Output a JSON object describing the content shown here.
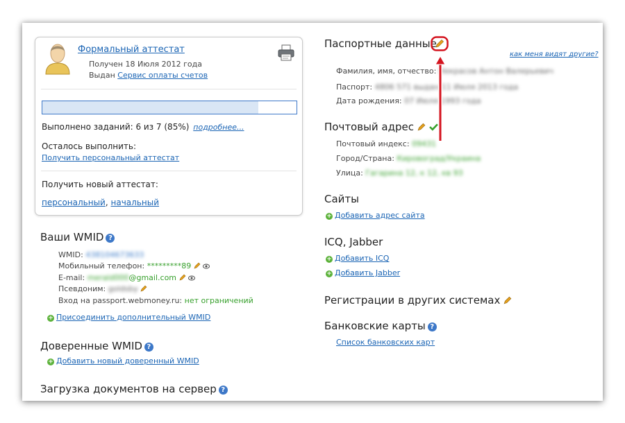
{
  "certificate": {
    "title": "Формальный аттестат",
    "received": "Получен 18 Июля 2012 года",
    "issued_prefix": "Выдан",
    "issued_link": "Сервис оплаты счетов",
    "progress_fraction": 0.85,
    "tasks_text": "Выполнено заданий: 6 из 7 (85%)",
    "more_link": "подробнее...",
    "remaining_label": "Осталось выполнить:",
    "get_personal_link": "Получить персональный аттестат",
    "new_cert_label": "Получить новый аттестат:",
    "new_personal_link": "персональный",
    "new_personal_sep": ",",
    "new_initial_link": "начальный"
  },
  "wmid": {
    "title": "Ваши WMID",
    "wmid_label": "WMID:",
    "wmid_value": "438104673633",
    "phone_label": "Мобильный телефон:",
    "phone_value": "*********89",
    "email_label": "E-mail:",
    "email_hidden": "merald000",
    "email_value": "@gmail.com",
    "nick_label": "Псевдоним:",
    "nick_value": "goldsby",
    "passport_label": "Вход на passport.webmoney.ru:",
    "passport_value": "нет ограничений",
    "attach_link": "Присоединить дополнительный WMID"
  },
  "trusted": {
    "title": "Доверенные WMID",
    "add_link": "Добавить новый доверенный WMID"
  },
  "upload": {
    "title": "Загрузка документов на сервер"
  },
  "passport": {
    "title": "Паспортные данные",
    "others_link": "как меня видят другие?",
    "fio_label": "Фамилия, имя, отчество:",
    "fio_value": "Некрасов Антон Валерьевич",
    "passport_label": "Паспорт:",
    "passport_value": "4806 571 выдан 11 Июля 2013 года",
    "birth_label": "Дата рождения:",
    "birth_value": "07 Июля 1993 года"
  },
  "postal": {
    "title": "Почтовый адрес",
    "index_label": "Почтовый индекс:",
    "index_value": "09431",
    "city_label": "Город/Страна:",
    "city_value": "Кировоград/Украина",
    "street_label": "Улица:",
    "street_value": "Гагарина 12, к 12, кв 93"
  },
  "sites": {
    "title": "Сайты",
    "add_link": "Добавить адрес сайта"
  },
  "icq": {
    "title": "ICQ, Jabber",
    "add_icq": "Добавить ICQ",
    "add_jabber": "Добавить Jabber"
  },
  "registrations": {
    "title": "Регистрации в других системах"
  },
  "cards": {
    "title": "Банковские карты",
    "list_link": "Список банковских карт"
  },
  "colors": {
    "link": "#1a64b4",
    "green": "#37a02c",
    "highlight": "#d4141f",
    "help": "#3d78c8"
  }
}
